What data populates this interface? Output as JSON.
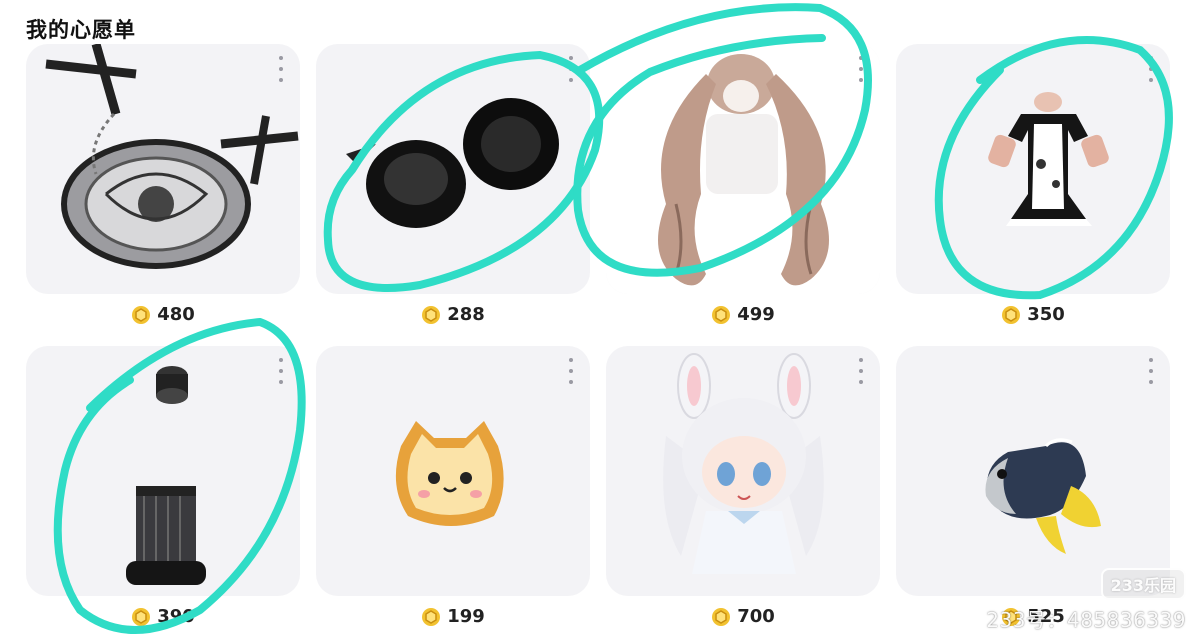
{
  "page": {
    "title": "我的心愿单"
  },
  "items": [
    {
      "name": "skull-plate-accessory",
      "price": "480"
    },
    {
      "name": "black-fur-ears",
      "price": "288"
    },
    {
      "name": "long-twin-tail-hair",
      "price": "499"
    },
    {
      "name": "maid-dress",
      "price": "350"
    },
    {
      "name": "platform-boots",
      "price": "390"
    },
    {
      "name": "toast-cat-pet",
      "price": "199"
    },
    {
      "name": "bunny-girl-avatar",
      "price": "700"
    },
    {
      "name": "fish-pet",
      "price": "525"
    }
  ],
  "watermark": {
    "logo": "233乐园",
    "id_text": "233号：485836339"
  },
  "colors": {
    "annotation": "#2fdcc6",
    "card_bg": "#f3f3f6",
    "coin": "#f2c230"
  }
}
